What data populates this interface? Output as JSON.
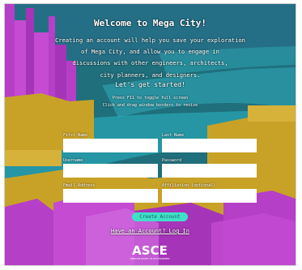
{
  "heading": "Welcome to Mega City!",
  "intro_lines": [
    "Creating an account will help you save your exploration",
    "of Mega City, and allow you to engage in",
    "discussions with other engineers, architects,",
    "city planners, and designers."
  ],
  "cta": "Let's get started!",
  "hints": [
    "Press F11 to toggle full screen",
    "Click and drag window borders to resize"
  ],
  "form": {
    "first_name_label": "First Name",
    "last_name_label": "Last Name",
    "username_label": "Username",
    "password_label": "Password",
    "email_label": "Email Address",
    "affiliation_label": "Affiliation (optional)",
    "first_name_value": "",
    "last_name_value": "",
    "username_value": "",
    "password_value": "",
    "email_value": "",
    "affiliation_value": ""
  },
  "submit_label": "Create Account",
  "login_link": "Have an Account? Log In",
  "logo": {
    "text": "ASCE",
    "tagline": "AMERICAN SOCIETY OF CIVIL ENGINEERS"
  },
  "colors": {
    "magenta": "#b63fc7",
    "gold": "#c8a227",
    "teal": "#1f6f7c",
    "button": "#3fe0c8"
  }
}
